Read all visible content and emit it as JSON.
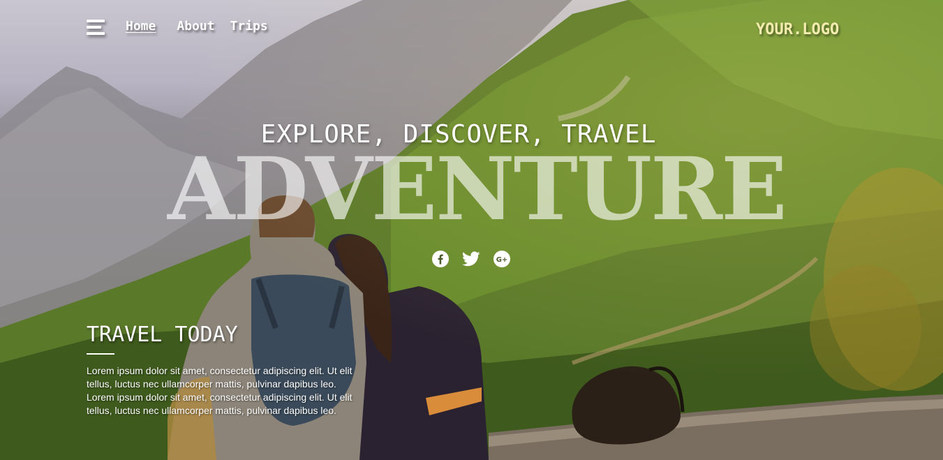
{
  "header": {
    "menu_icon": "hamburger-icon",
    "nav": [
      {
        "label": "Home",
        "active": true
      },
      {
        "label": "About",
        "active": false
      },
      {
        "label": "Trips",
        "active": false
      }
    ],
    "logo": "YOUR.LOGO"
  },
  "hero": {
    "tagline": "EXPLORE, DISCOVER, TRAVEL",
    "headline": "ADVENTURE",
    "social": [
      {
        "name": "facebook-icon"
      },
      {
        "name": "twitter-icon"
      },
      {
        "name": "google-plus-icon"
      }
    ]
  },
  "section": {
    "title": "TRAVEL TODAY",
    "body": "Lorem ipsum dolor sit amet, consectetur adipiscing elit. Ut elit tellus, luctus nec ullamcorper mattis, pulvinar dapibus leo. Lorem ipsum dolor sit amet, consectetur adipiscing elit. Ut elit tellus, luctus nec ullamcorper mattis, pulvinar dapibus leo."
  },
  "colors": {
    "logo": "#f4ecae",
    "text": "#ffffff"
  }
}
